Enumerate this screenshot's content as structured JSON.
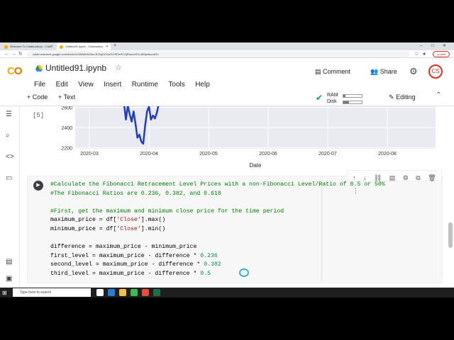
{
  "browser": {
    "tabs": [
      {
        "label": "Welcome To Colaboratory - Cola"
      },
      {
        "label": "Untitled91.ipynb - Colaborator"
      }
    ],
    "url": "colab.research.google.com/drive/1o3X8WHhtXkz-RJ3qOCDa7KH57eHCXjPwzcoRTo-8Wjc#scrollTo",
    "update_label": "Update"
  },
  "notebook": {
    "title": "Untitled91.ipynb",
    "menu": [
      "File",
      "Edit",
      "View",
      "Insert",
      "Runtime",
      "Tools",
      "Help"
    ],
    "comment_label": "Comment",
    "share_label": "Share",
    "avatar_initials": "CS"
  },
  "toolbar": {
    "add_code": "+ Code",
    "add_text": "+ Text",
    "ram_label": "RAM",
    "disk_label": "Disk",
    "ram_fraction": 0.12,
    "disk_fraction": 0.3,
    "editing_label": "Editing"
  },
  "output": {
    "exec_count": "[5]"
  },
  "chart_data": {
    "type": "line",
    "xlabel": "Date",
    "ylabel": "",
    "x_ticks": [
      "2020-03",
      "2020-04",
      "2020-05",
      "2020-06",
      "2020-07",
      "2020-08"
    ],
    "y_ticks": [
      2200,
      2400,
      2600
    ],
    "ylim": [
      2190,
      2640
    ],
    "grid": true,
    "line_color": "#1f3fbf",
    "series": [
      {
        "x": [
          "2020-03-19",
          "2020-03-20",
          "2020-03-21",
          "2020-03-22",
          "2020-03-23",
          "2020-03-24",
          "2020-03-25",
          "2020-03-26",
          "2020-03-27",
          "2020-03-28",
          "2020-03-29",
          "2020-03-30",
          "2020-03-31",
          "2020-04-01",
          "2020-04-02",
          "2020-04-03",
          "2020-04-04",
          "2020-04-05",
          "2020-04-06"
        ],
        "values": [
          2640,
          2480,
          2620,
          2530,
          2460,
          2560,
          2440,
          2300,
          2330,
          2260,
          2240,
          2420,
          2560,
          2610,
          2480,
          2520,
          2490,
          2550,
          2640
        ]
      }
    ]
  },
  "code": [
    {
      "type": "comment",
      "text": "#Calculate the Fibonacci Retracement Level Prices with a non-Fibonacci Level/Ratio of 0.5 or 50%"
    },
    {
      "type": "comment",
      "text": "#The Fibonacci Ratios are 0.236, 0.382, and 0.618"
    },
    {
      "type": "blank",
      "text": ""
    },
    {
      "type": "comment",
      "text": "#First, get the maximum and minimum close price for the time period"
    },
    {
      "type": "code",
      "pre": "maximum_price = df[",
      "str": "'Close'",
      "post": "].max()"
    },
    {
      "type": "code",
      "pre": "minimum_price = df[",
      "str": "'Close'",
      "post": "].min()"
    },
    {
      "type": "blank",
      "text": ""
    },
    {
      "type": "plain",
      "text": "difference = maximum_price - minimum_price"
    },
    {
      "type": "num",
      "pre": "first_level = maximum_price - difference * ",
      "num": "0.236"
    },
    {
      "type": "num",
      "pre": "second_level = maximum_price - difference * ",
      "num": "0.382"
    },
    {
      "type": "num",
      "pre": "third_level = maximum_price - difference * ",
      "num": "0.5"
    }
  ],
  "taskbar": {
    "search_placeholder": "Type here to search",
    "time": "",
    "icons": [
      {
        "name": "task-view-icon",
        "color": "#ffffff"
      },
      {
        "name": "edge-icon",
        "color": "#2b7bd3"
      },
      {
        "name": "explorer-icon",
        "color": "#f3c04a"
      },
      {
        "name": "chrome-icon",
        "color": "#3cba54"
      },
      {
        "name": "app-icon",
        "color": "#e74c3c"
      },
      {
        "name": "excel-icon",
        "color": "#1e7145"
      }
    ]
  }
}
